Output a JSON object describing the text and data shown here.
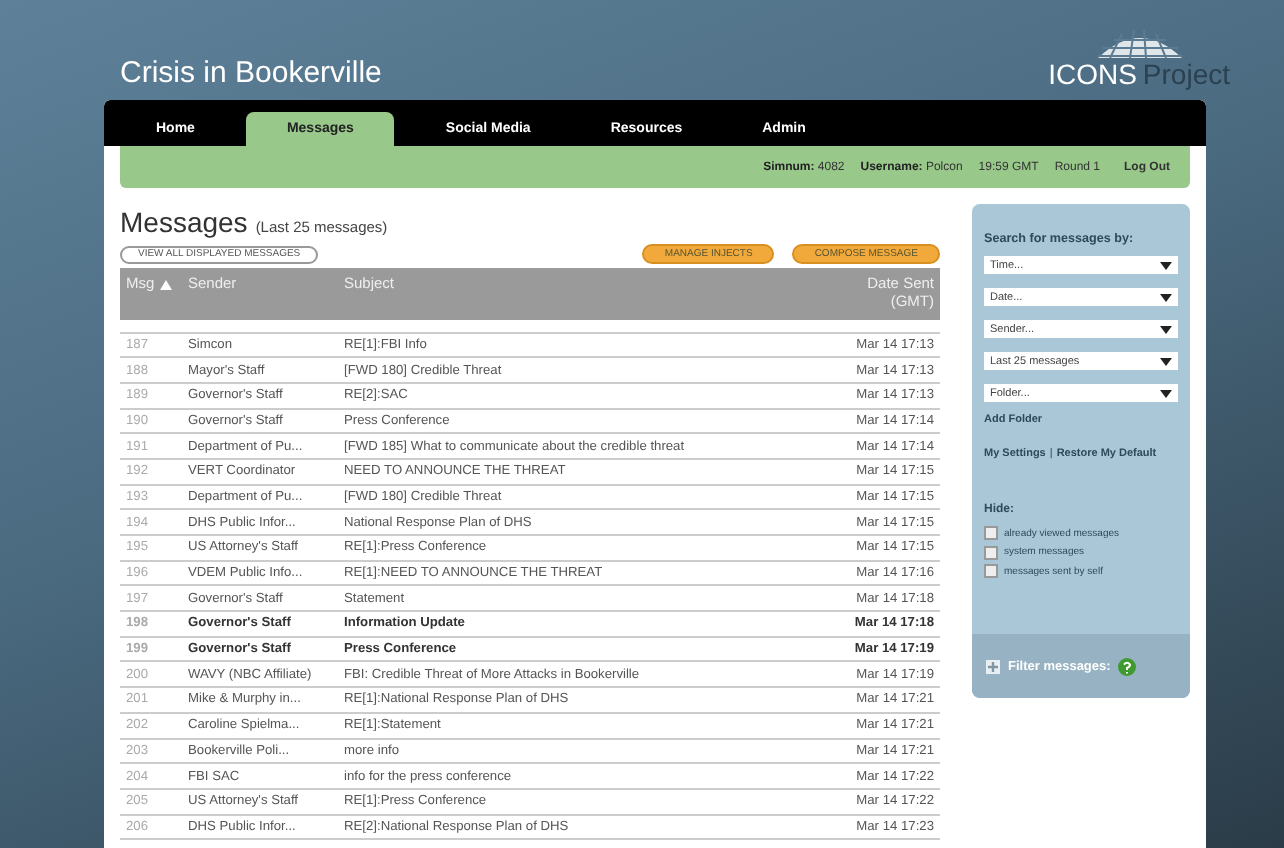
{
  "app_title": "Crisis in Bookerville",
  "logo": {
    "text": "ICONS",
    "suffix": "Project"
  },
  "nav": [
    {
      "label": "Home",
      "selected": false
    },
    {
      "label": "Messages",
      "selected": true
    },
    {
      "label": "Social Media",
      "selected": false
    },
    {
      "label": "Resources",
      "selected": false
    },
    {
      "label": "Admin",
      "selected": false
    }
  ],
  "status_bar": {
    "fields": [
      {
        "label": "Simnum:",
        "value": "4082"
      },
      {
        "label": "Username:",
        "value": "Polcon"
      }
    ],
    "time": "19:59 GMT",
    "round": "Round 1",
    "logout": "Log Out"
  },
  "page": {
    "title": "Messages",
    "subtitle": "(Last 25 messages)",
    "view_all": "VIEW ALL DISPLAYED MESSAGES",
    "actions": [
      "MANAGE INJECTS",
      "COMPOSE MESSAGE"
    ]
  },
  "table": {
    "columns": [
      {
        "label": "Msg",
        "sorted": true
      },
      {
        "label": "Sender",
        "sorted": false
      },
      {
        "label": "Subject",
        "sorted": false
      },
      {
        "label": "Date Sent (GMT)",
        "sorted": false
      }
    ],
    "rows": [
      {
        "msg": "187",
        "sender": "Simcon",
        "subject": "RE[1]:FBI Info",
        "date": "Mar 14 17:13",
        "unread": false
      },
      {
        "msg": "188",
        "sender": "Mayor's Staff",
        "subject": "[FWD 180] Credible Threat",
        "date": "Mar 14 17:13",
        "unread": false
      },
      {
        "msg": "189",
        "sender": "Governor's Staff",
        "subject": "RE[2]:SAC",
        "date": "Mar 14 17:13",
        "unread": false
      },
      {
        "msg": "190",
        "sender": "Governor's Staff",
        "subject": "Press Conference",
        "date": "Mar 14 17:14",
        "unread": false
      },
      {
        "msg": "191",
        "sender": "Department of Pu...",
        "subject": "[FWD 185] What to communicate about the credible threat",
        "date": "Mar 14 17:14",
        "unread": false
      },
      {
        "msg": "192",
        "sender": "VERT Coordinator",
        "subject": "NEED TO ANNOUNCE THE THREAT",
        "date": "Mar 14 17:15",
        "unread": false
      },
      {
        "msg": "193",
        "sender": "Department of Pu...",
        "subject": "[FWD 180] Credible Threat",
        "date": "Mar 14 17:15",
        "unread": false
      },
      {
        "msg": "194",
        "sender": "DHS Public Infor...",
        "subject": "National Response Plan of DHS",
        "date": "Mar 14 17:15",
        "unread": false
      },
      {
        "msg": "195",
        "sender": "US Attorney's Staff",
        "subject": "RE[1]:Press Conference",
        "date": "Mar 14 17:15",
        "unread": false
      },
      {
        "msg": "196",
        "sender": "VDEM Public Info...",
        "subject": "RE[1]:NEED TO ANNOUNCE THE THREAT",
        "date": "Mar 14 17:16",
        "unread": false
      },
      {
        "msg": "197",
        "sender": "Governor's Staff",
        "subject": "Statement",
        "date": "Mar 14 17:18",
        "unread": false
      },
      {
        "msg": "198",
        "sender": "Governor's Staff",
        "subject": "Information Update",
        "date": "Mar 14 17:18",
        "unread": true
      },
      {
        "msg": "199",
        "sender": "Governor's Staff",
        "subject": "Press Conference",
        "date": "Mar 14 17:19",
        "unread": true
      },
      {
        "msg": "200",
        "sender": "WAVY (NBC Affiliate)",
        "subject": "FBI: Credible Threat of More Attacks in Bookerville",
        "date": "Mar 14 17:19",
        "unread": false
      },
      {
        "msg": "201",
        "sender": "Mike & Murphy in...",
        "subject": "RE[1]:National Response Plan of DHS",
        "date": "Mar 14 17:21",
        "unread": false
      },
      {
        "msg": "202",
        "sender": "Caroline Spielma...",
        "subject": "RE[1]:Statement",
        "date": "Mar 14 17:21",
        "unread": false
      },
      {
        "msg": "203",
        "sender": "Bookerville Poli...",
        "subject": "more info",
        "date": "Mar 14 17:21",
        "unread": false
      },
      {
        "msg": "204",
        "sender": "FBI SAC",
        "subject": "info for the press conference",
        "date": "Mar 14 17:22",
        "unread": false
      },
      {
        "msg": "205",
        "sender": "US Attorney's Staff",
        "subject": "RE[1]:Press Conference",
        "date": "Mar 14 17:22",
        "unread": false
      },
      {
        "msg": "206",
        "sender": "DHS Public Infor...",
        "subject": "RE[2]:National Response Plan of DHS",
        "date": "Mar 14 17:23",
        "unread": false
      }
    ]
  },
  "sidebar": {
    "heading": "Search for messages by:",
    "dropdowns": [
      "Time...",
      "Date...",
      "Sender...",
      "Last 25 messages",
      "Folder..."
    ],
    "add_folder": "Add Folder",
    "settings_link": "My Settings",
    "restore_link": "Restore My Default",
    "separator": "|",
    "hide_label": "Hide:",
    "hide_options": [
      {
        "label": "already viewed messages",
        "checked": false
      },
      {
        "label": "system messages",
        "checked": false
      },
      {
        "label": "messages sent by self",
        "checked": false
      }
    ],
    "filter": {
      "label": "Filter messages:",
      "expanded": false
    }
  }
}
